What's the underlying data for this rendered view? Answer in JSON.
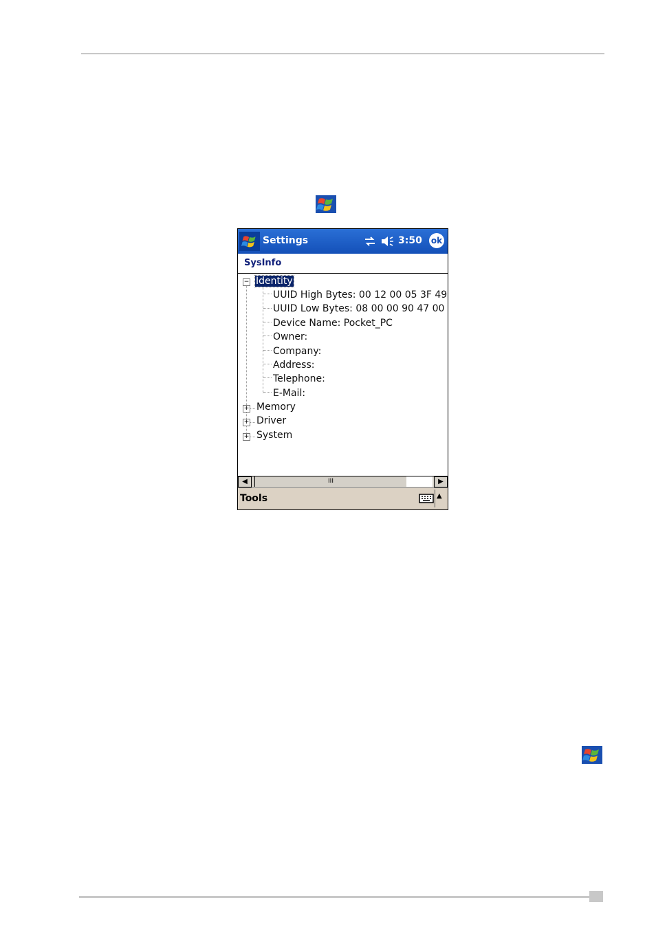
{
  "device": {
    "titlebar": {
      "title": "Settings",
      "time": "3:50",
      "ok_label": "ok"
    },
    "subtitle": "SysInfo",
    "tree": {
      "root": {
        "label": "Identity",
        "toggle": "−"
      },
      "identity_items": [
        "UUID High Bytes: 00 12 00 05 3F 49",
        "UUID Low Bytes: 08 00 00 90 47 00",
        "Device Name: Pocket_PC",
        "Owner:",
        "Company:",
        "Address:",
        "Telephone:",
        "E-Mail:"
      ],
      "collapsed_nodes": [
        "Memory",
        "Driver",
        "System"
      ],
      "collapsed_toggle": "+"
    },
    "scrollbar": {
      "left_arrow": "◀",
      "right_arrow": "▶",
      "thumb_grip": "III"
    },
    "menubar": {
      "tools_label": "Tools",
      "sip_arrow": "▲"
    }
  },
  "icons": {
    "windows_start": "windows-flag-icon",
    "connectivity": "connectivity-arrows-icon",
    "volume": "speaker-icon",
    "keyboard": "keyboard-icon"
  }
}
